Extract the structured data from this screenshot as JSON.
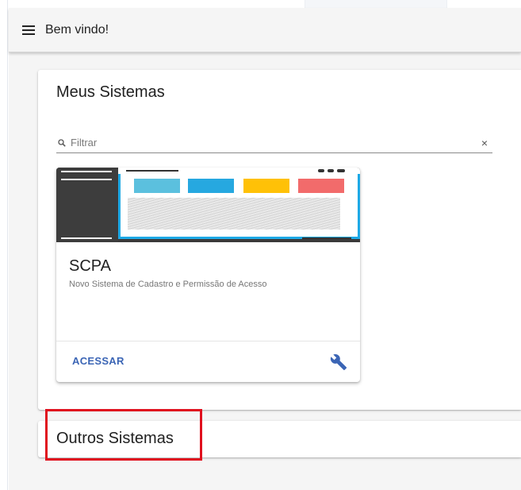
{
  "toolbar": {
    "menu_icon": "menu-icon",
    "title": "Bem vindo!"
  },
  "meus_sistemas": {
    "title": "Meus Sistemas",
    "filter": {
      "placeholder": "Filtrar",
      "value": "",
      "search_icon": "search-icon",
      "clear_icon": "close-icon",
      "clear_symbol": "×"
    },
    "cards": [
      {
        "title": "SCPA",
        "subtitle": "Novo Sistema de Cadastro e Permissão de Acesso",
        "action_label": "ACESSAR",
        "settings_icon": "wrench-icon",
        "thumbnail_colors": [
          "#5bc0de",
          "#26a8e0",
          "#ffc107",
          "#f26b6b"
        ]
      }
    ]
  },
  "outros_sistemas": {
    "title": "Outros Sistemas"
  },
  "colors": {
    "accent": "#3b65b5",
    "highlight": "#e0101e",
    "thumb_border": "#1da9e6"
  }
}
